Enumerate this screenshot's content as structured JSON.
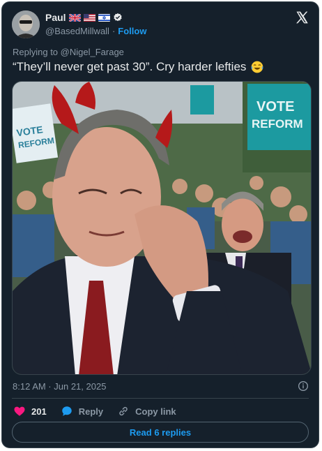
{
  "author": {
    "name": "Paul",
    "handle": "@BasedMillwall",
    "separator": "·",
    "follow_label": "Follow",
    "flags": [
      "uk-flag-icon",
      "us-flag-icon",
      "israel-flag-icon"
    ],
    "verified_icon": "verified-badge-icon"
  },
  "reply_context": {
    "prefix": "Replying to",
    "mention": "@Nigel_Farage"
  },
  "tweet": {
    "text": "“They’ll never get past 30”. Cry harder lefties",
    "emoji": "tears-of-joy-emoji"
  },
  "media": {
    "signs": [
      "VOTE",
      "REFORM",
      "VOTE",
      "REFORM"
    ]
  },
  "meta": {
    "timestamp": "8:12 AM · Jun 21, 2025"
  },
  "actions": {
    "like_count": "201",
    "reply_label": "Reply",
    "copy_link_label": "Copy link"
  },
  "read_replies_label": "Read 6 replies",
  "colors": {
    "background": "#15202b",
    "accent": "#1d9bf0",
    "like": "#f91880",
    "muted": "#8b98a5"
  }
}
